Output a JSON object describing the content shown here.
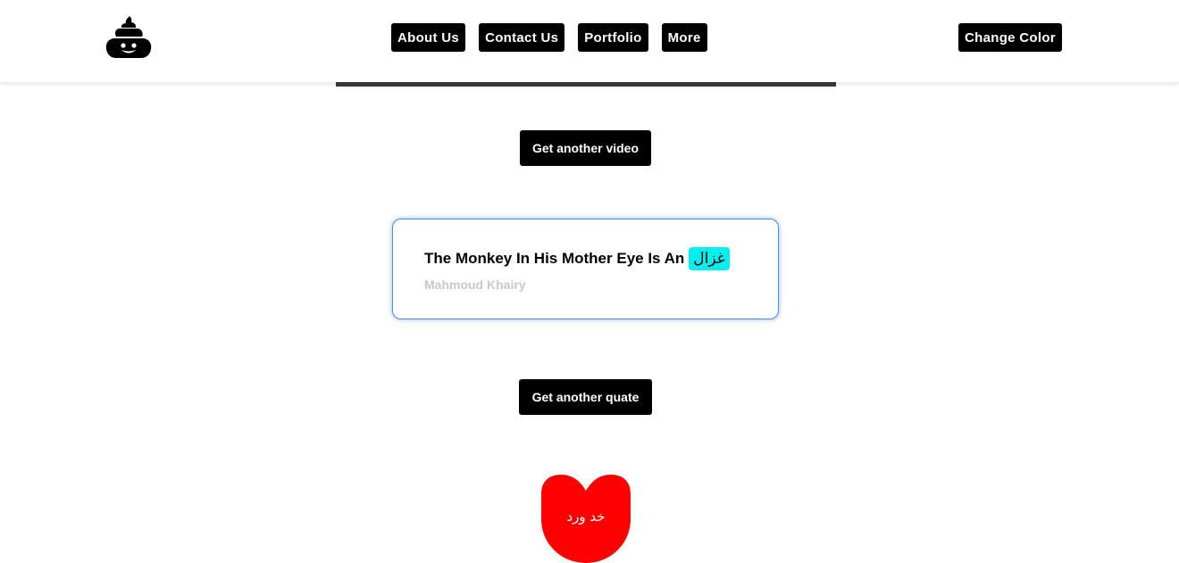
{
  "header": {
    "logo_icon": "poop-emoji-icon",
    "nav": [
      {
        "label": "About Us"
      },
      {
        "label": "Contact Us"
      },
      {
        "label": "Portfolio"
      },
      {
        "label": "More"
      }
    ],
    "change_color_label": "Change Color"
  },
  "video": {
    "button_label": "Get another video"
  },
  "quote": {
    "text": "The Monkey In His Mother Eye Is An",
    "highlight": "غزال",
    "author": "Mahmoud Khairy",
    "button_label": "Get another quate"
  },
  "heart": {
    "text": "خد ورد",
    "color": "#ff0000"
  },
  "colors": {
    "button_bg": "#000000",
    "button_text": "#ffffff",
    "highlight_bg": "#00f0f0",
    "author_text": "#c8c8c8",
    "card_border": "#4a8fe7"
  }
}
